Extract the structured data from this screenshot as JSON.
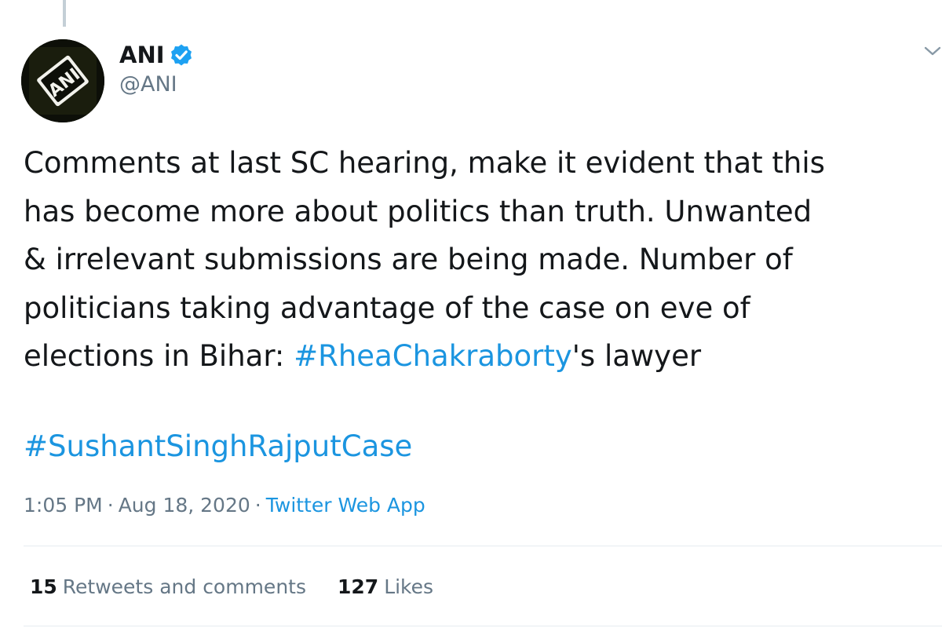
{
  "author": {
    "display_name": "ANI",
    "handle": "@ANI",
    "verified": true,
    "avatar_text": "ANI"
  },
  "tweet": {
    "text_lines": [
      "Comments at last SC hearing, make it evident that this",
      "has become more about politics than truth. Unwanted",
      "& irrelevant submissions are being made. Number of",
      "politicians taking advantage of the case on eve of",
      "elections in Bihar: "
    ],
    "inline_hashtag": "#RheaChakraborty",
    "text_tail": "'s lawyer",
    "hashtag_line": "#SushantSinghRajputCase"
  },
  "meta": {
    "time": "1:05 PM",
    "separator": "·",
    "date": "Aug 18, 2020",
    "source": "Twitter Web App"
  },
  "stats": {
    "retweets_count": "15",
    "retweets_label": "Retweets and comments",
    "likes_count": "127",
    "likes_label": "Likes"
  },
  "icons": {
    "verified": "verified-badge-icon",
    "caret": "chevron-down-icon"
  },
  "colors": {
    "link": "#1b95e0",
    "text": "#14171a",
    "muted": "#657786",
    "divider": "#e6ecf0",
    "verified": "#1da1f2"
  }
}
